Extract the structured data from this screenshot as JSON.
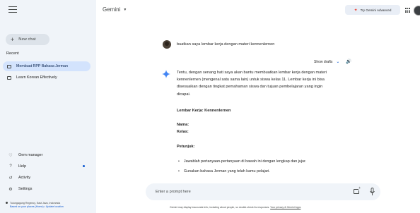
{
  "sidebar": {
    "new_chat_label": "New chat",
    "recent_label": "Recent",
    "recent_items": [
      {
        "label": "Membuat RPP Bahasa Jerman",
        "active": true
      },
      {
        "label": "Learn Korean Effectively",
        "active": false
      }
    ],
    "bottom_items": [
      {
        "label": "Gem manager",
        "icon": "gem-icon"
      },
      {
        "label": "Help",
        "icon": "help-icon"
      },
      {
        "label": "Activity",
        "icon": "activity-icon"
      },
      {
        "label": "Settings",
        "icon": "settings-icon"
      }
    ],
    "location": "Tulungagung Regency, East Java, Indonesia",
    "location_source": "Based on your places (Home) • Update location"
  },
  "header": {
    "brand": "Gemini",
    "try_advanced_label": "Try Gemini Advanced"
  },
  "conversation": {
    "user_message": "buatkan saya lembar kerja dengan materi kennenlernen",
    "show_drafts_label": "Show drafts",
    "response": {
      "intro_lines": [
        "Tentu, dengan senang hati saya akan bantu membuatkan lembar kerja dengan materi",
        "kennenlernen (mengenal satu sama lain) untuk siswa kelas 11. Lembar kerja ini bisa",
        "disesuaikan dengan tingkat pemahaman siswa dan tujuan pembelajaran yang ingin",
        "dicapai."
      ],
      "heading": "Lembar Kerja: Kennenlernen",
      "fields": [
        "Nama:",
        "Kelas:"
      ],
      "instructions_heading": "Petunjuk:",
      "bullets": [
        "Jawablah pertanyaan-pertanyaan di bawah ini dengan lengkap dan jujur.",
        "Gunakan bahasa Jerman yang telah kamu pelajari."
      ]
    }
  },
  "prompt": {
    "placeholder": "Enter a prompt here"
  },
  "footer": {
    "disclaimer": "Gemini may display inaccurate info, including about people, so double-check its responses.",
    "privacy_link": "Your privacy & Gemini Apps"
  },
  "colors": {
    "sidebar_bg": "#f0f4f9",
    "active_item_bg": "#d3e3fd",
    "accent_blue": "#0b57d0",
    "sparkle_blue": "#4285f4"
  }
}
